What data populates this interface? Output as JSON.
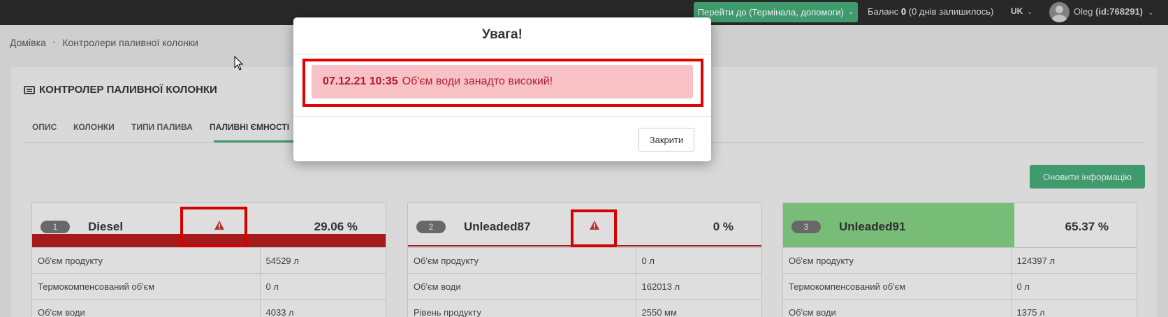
{
  "topbar": {
    "goto_label": "Перейти до (Термінала, допомоги)",
    "balance_prefix": "Баланс",
    "balance_value": "0",
    "balance_suffix": "(0 днів залишилось)",
    "lang": "UK",
    "user_name": "Oleg",
    "user_id": "(id:768291)"
  },
  "breadcrumb": [
    "Домівка",
    "Контролери паливної колонки"
  ],
  "panel": {
    "title": "КОНТРОЛЕР ПАЛИВНОЇ КОЛОНКИ",
    "tabs": [
      "ОПИС",
      "КОЛОНКИ",
      "ТИПИ ПАЛИВА",
      "ПАЛИВНІ ЄМНОСТІ"
    ],
    "active_tab": "ПАЛИВНІ ЄМНОСТІ",
    "refresh_label": "Оновити інформацію"
  },
  "tanks": [
    {
      "number": "1",
      "name": "Diesel",
      "percent": "29.06 %",
      "fill_fraction": 0.2906,
      "status": "warning",
      "warning_icon": "warning-triangle-icon",
      "rows": [
        {
          "label": "Об'єм продукту",
          "value": "54529 л"
        },
        {
          "label": "Термокомпенсований об'єм",
          "value": "0 л"
        },
        {
          "label": "Об'єм води",
          "value": "4033 л"
        }
      ]
    },
    {
      "number": "2",
      "name": "Unleaded87",
      "percent": "0 %",
      "fill_fraction": 0,
      "status": "warning",
      "warning_icon": "warning-triangle-icon",
      "rows": [
        {
          "label": "Об'єм продукту",
          "value": "0 л"
        },
        {
          "label": "Об'єм води",
          "value": "162013 л"
        },
        {
          "label": "Рівень продукту",
          "value": "2550 мм"
        }
      ]
    },
    {
      "number": "3",
      "name": "Unleaded91",
      "percent": "65.37 %",
      "fill_fraction": 0.6537,
      "status": "ok",
      "rows": [
        {
          "label": "Об'єм продукту",
          "value": "124397 л"
        },
        {
          "label": "Термокомпенсований об'єм",
          "value": "0 л"
        },
        {
          "label": "Об'єм води",
          "value": "1375 л"
        }
      ]
    }
  ],
  "modal": {
    "title": "Увага!",
    "alert_time": "07.12.21 10:35",
    "alert_text": "Об'єм води занадто високий!",
    "close_label": "Закрити"
  },
  "colors": {
    "accent_green": "#43a474",
    "alert_red": "#b01c1c",
    "highlight_red": "#e30000",
    "tank_ok_fill": "#7fc87f",
    "alert_bg": "#f7c1c6"
  }
}
